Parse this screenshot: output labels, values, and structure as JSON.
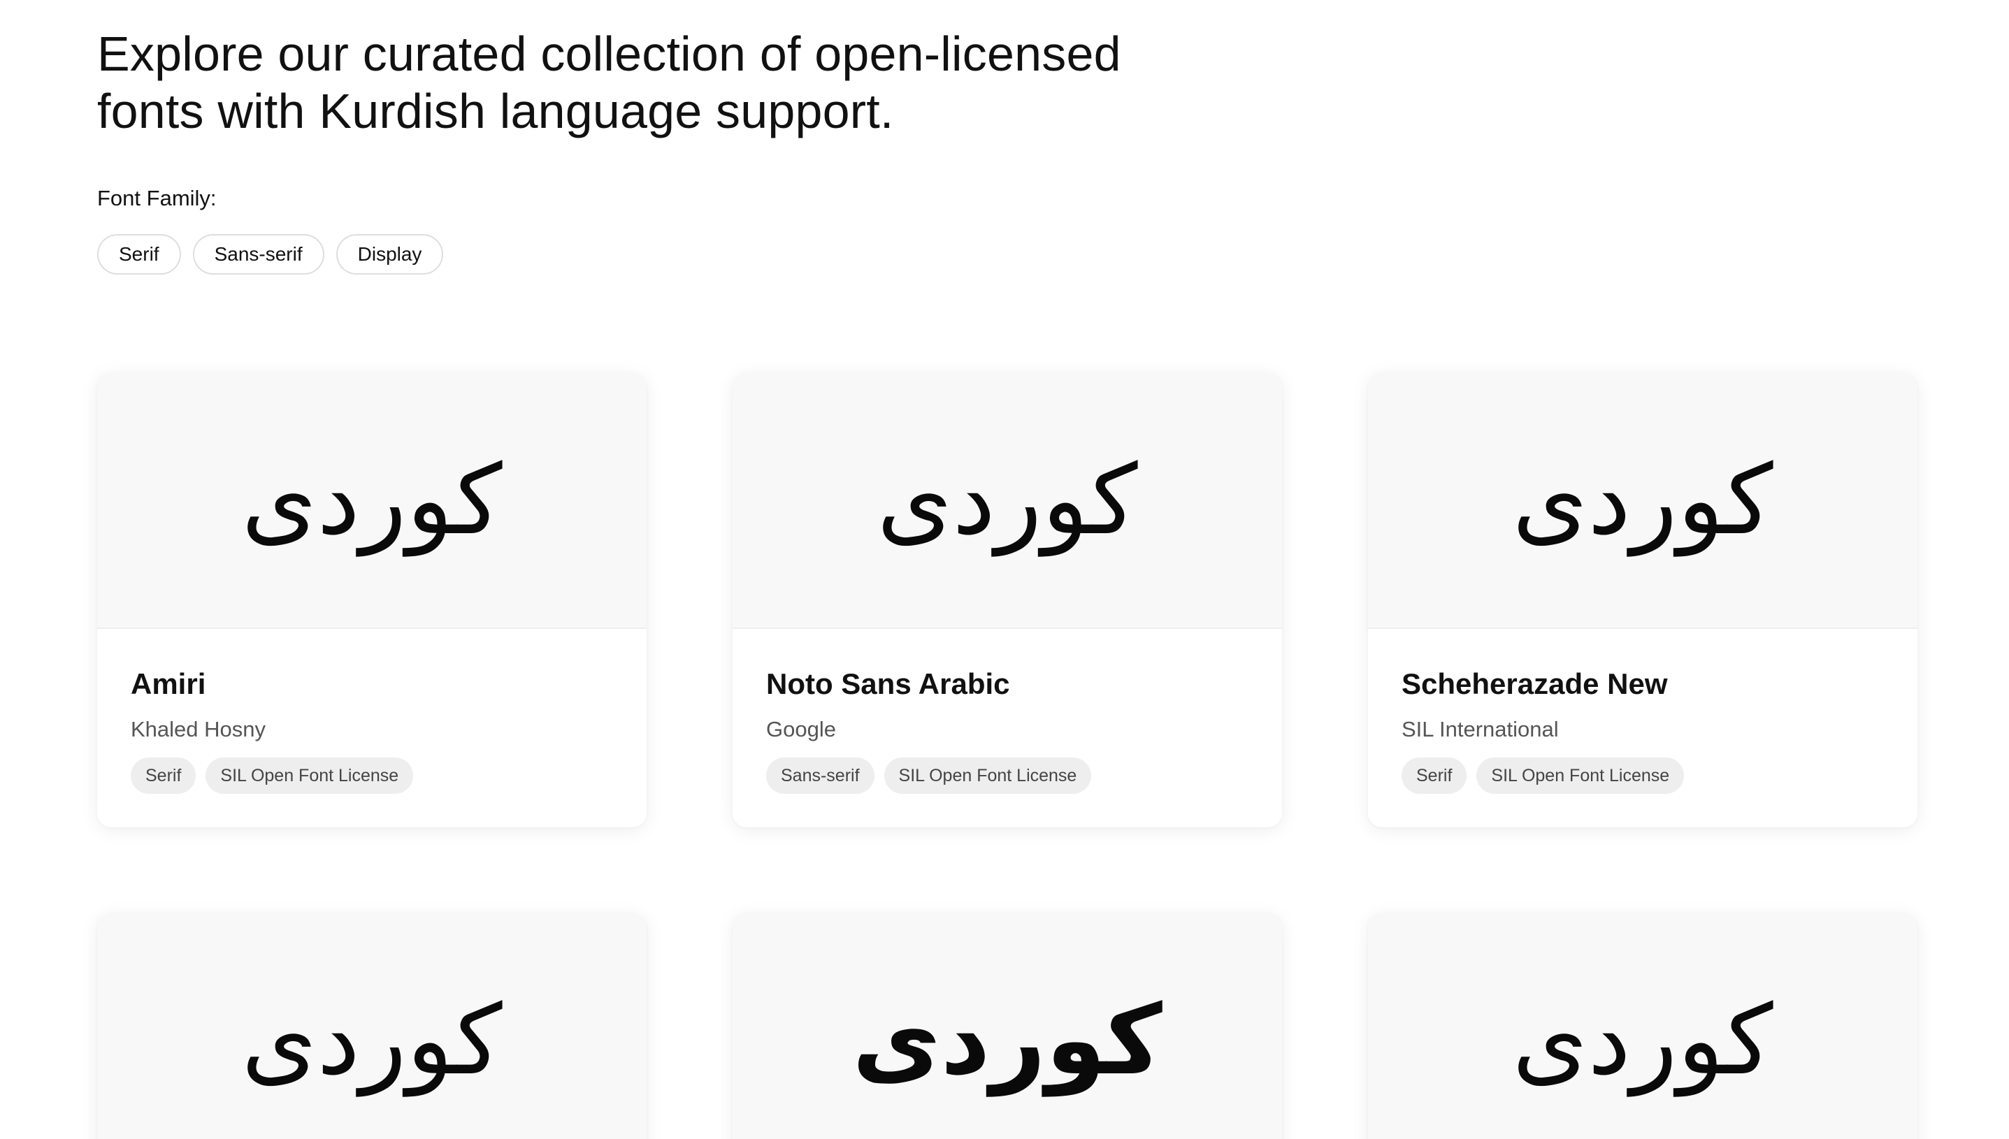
{
  "intro": {
    "line1": "Explore our curated collection of open-licensed",
    "line2": "fonts with Kurdish language support."
  },
  "filters": {
    "label": "Font Family:",
    "options": [
      "Serif",
      "Sans-serif",
      "Display"
    ]
  },
  "fonts": [
    {
      "preview": "کوردی",
      "name": "Amiri",
      "designer": "Khaled Hosny",
      "tags": [
        "Serif",
        "SIL Open Font License"
      ]
    },
    {
      "preview": "کوردی",
      "name": "Noto Sans Arabic",
      "designer": "Google",
      "tags": [
        "Sans-serif",
        "SIL Open Font License"
      ]
    },
    {
      "preview": "کوردی",
      "name": "Scheherazade New",
      "designer": "SIL International",
      "tags": [
        "Serif",
        "SIL Open Font License"
      ]
    },
    {
      "preview": "کوردی"
    },
    {
      "preview": "کوردی"
    },
    {
      "preview": "کوردی"
    }
  ]
}
